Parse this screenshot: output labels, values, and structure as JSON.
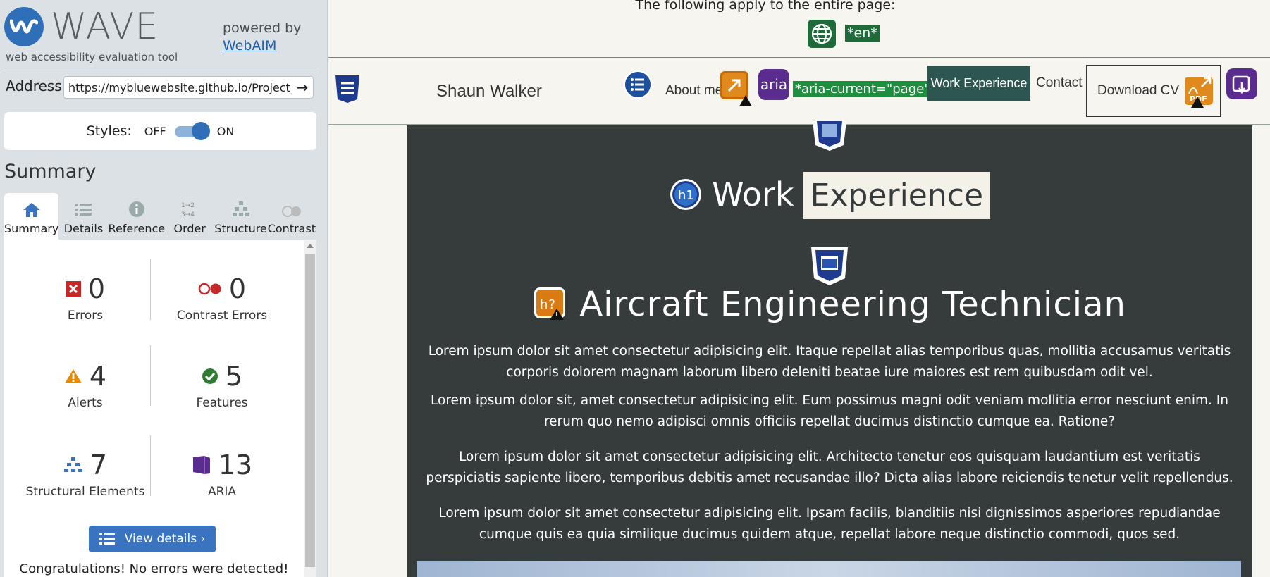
{
  "wave": {
    "logo_text": "WAVE",
    "tagline": "web accessibility evaluation tool",
    "powered_by": "powered by",
    "webaim_link": "WebAIM",
    "address_label": "Address:",
    "address_value": "https://mybluewebsite.github.io/Project_Mil",
    "go_icon": "arrow-right-icon",
    "styles_label": "Styles:",
    "styles_off": "OFF",
    "styles_on": "ON",
    "summary_title": "Summary",
    "tabs": [
      {
        "label": "Summary",
        "icon": "home-icon",
        "active": true
      },
      {
        "label": "Details",
        "icon": "list-icon",
        "active": false
      },
      {
        "label": "Reference",
        "icon": "info-icon",
        "active": false
      },
      {
        "label": "Order",
        "icon": "order-icon",
        "active": false
      },
      {
        "label": "Structure",
        "icon": "structure-icon",
        "active": false
      },
      {
        "label": "Contrast",
        "icon": "contrast-icon",
        "active": false
      }
    ],
    "stats": [
      {
        "count": "0",
        "label": "Errors",
        "color": "#c62828"
      },
      {
        "count": "0",
        "label": "Contrast Errors",
        "color": "#c62828"
      },
      {
        "count": "4",
        "label": "Alerts",
        "color": "#e68a00"
      },
      {
        "count": "5",
        "label": "Features",
        "color": "#2e7d32"
      },
      {
        "count": "7",
        "label": "Structural Elements",
        "color": "#3a74c0"
      },
      {
        "count": "13",
        "label": "ARIA",
        "color": "#5b2c8f"
      }
    ],
    "view_details": "View details ›",
    "congrats": "Congratulations! No errors were detected!"
  },
  "page": {
    "global_note": "The following apply to the entire page:",
    "lang_tag": "*en*",
    "nav": {
      "brand": "Shaun Walker",
      "about": "About me",
      "aria_badge": "aria",
      "aria_current": "*aria-current=\"page\"*",
      "work": "Work Experience",
      "contact": "Contact",
      "download": "Download CV"
    },
    "h1_badge": "h1",
    "h1_work": "Work",
    "h1_experience": "Experience",
    "h_badge": "h?",
    "job_title": "Aircraft Engineering Technician",
    "paragraphs": [
      "Lorem ipsum dolor sit amet consectetur adipisicing elit. Itaque repellat alias temporibus quas, mollitia accusamus veritatis corporis dolorem magnam laborum libero deleniti beatae iure maiores est rem quibusdam odit vel.",
      "Lorem ipsum dolor sit, amet consectetur adipisicing elit. Eum possimus magni odit veniam mollitia error nesciunt enim. In rerum quo nemo adipisci omnis officiis repellat ducimus distinctio cumque ea. Ratione?",
      "Lorem ipsum dolor sit amet consectetur adipisicing elit. Architecto tenetur eos quisquam laudantium est veritatis perspiciatis sapiente libero, temporibus debitis amet recusandae illo? Dicta alias labore reiciendis tenetur velit repellendus.",
      "Lorem ipsum dolor sit amet consectetur adipisicing elit. Ipsam facilis, blanditiis nisi dignissimos asperiores repudiandae cumque quis ea quia similique ducimus quidem atque, repellat labore neque distinctio commodi, quos sed."
    ]
  }
}
